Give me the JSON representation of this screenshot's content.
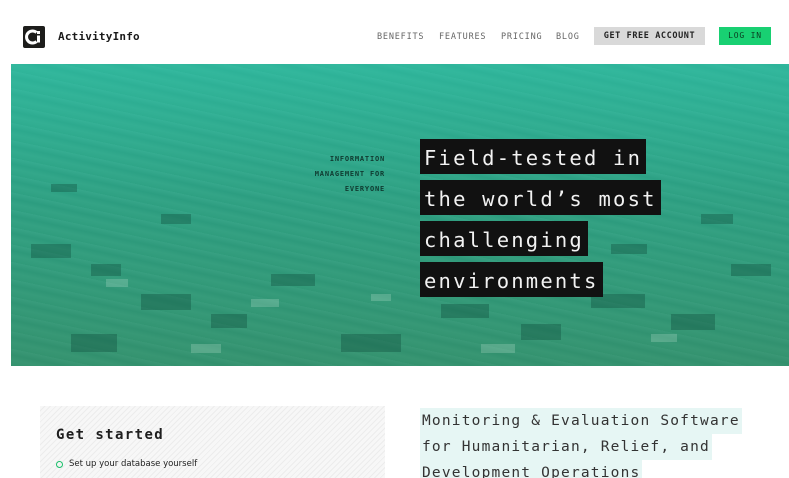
{
  "header": {
    "brand": "ActivityInfo",
    "logo_icon": "activityinfo-logo-icon",
    "nav": [
      "BENEFITS",
      "FEATURES",
      "PRICING",
      "BLOG"
    ],
    "cta_free": "GET FREE ACCOUNT",
    "cta_login": "LOG IN"
  },
  "hero": {
    "tagline": [
      "INFORMATION",
      "MANAGEMENT FOR",
      "EVERYONE"
    ],
    "headline": [
      "Field-tested in",
      "the world’s most",
      "challenging",
      "environments"
    ]
  },
  "get_started": {
    "title": "Get started",
    "item_1": "Set up your database yourself"
  },
  "subheading": [
    "Monitoring & Evaluation Software",
    "for Humanitarian, Relief, and",
    "Development Operations"
  ],
  "colors": {
    "accent_green": "#18d072",
    "hero_teal": "#29bea5",
    "headline_bg": "#111111",
    "button_grey": "#d9d9d9"
  }
}
